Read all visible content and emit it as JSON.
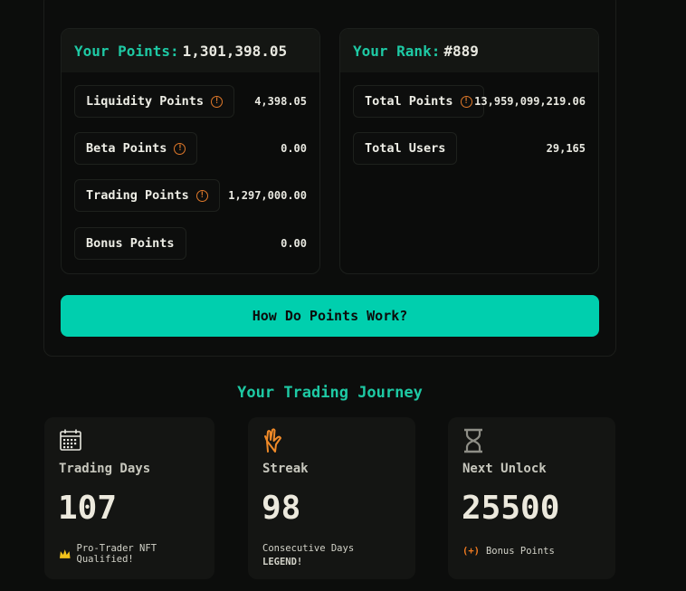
{
  "points": {
    "your_points_label": "Your Points:",
    "your_points_value": "1,301,398.05",
    "rows": [
      {
        "label": "Liquidity Points",
        "value": "4,398.05",
        "info": true
      },
      {
        "label": "Beta Points",
        "value": "0.00",
        "info": true
      },
      {
        "label": "Trading Points",
        "value": "1,297,000.00",
        "info": true
      },
      {
        "label": "Bonus Points",
        "value": "0.00",
        "info": false
      }
    ]
  },
  "rank": {
    "your_rank_label": "Your Rank:",
    "your_rank_value": "#889",
    "rows": [
      {
        "label": "Total Points",
        "value": "13,959,099,219.06",
        "info": true
      },
      {
        "label": "Total Users",
        "value": "29,165",
        "info": false
      }
    ]
  },
  "cta": {
    "label": "How Do Points Work?"
  },
  "journey": {
    "title": "Your Trading Journey",
    "cards": [
      {
        "icon": "calendar-icon",
        "label": "Trading Days",
        "value": "107",
        "note": "Pro-Trader NFT Qualified!"
      },
      {
        "icon": "hand-icon",
        "label": "Streak",
        "value": "98",
        "note": "Consecutive Days",
        "note2": "LEGEND!"
      },
      {
        "icon": "hourglass-icon",
        "label": "Next Unlock",
        "value": "25500",
        "note_prefix": "(+)",
        "note": "Bonus Points"
      }
    ]
  },
  "colors": {
    "accent": "#1ec9a4",
    "button": "#00cfae",
    "warning": "#e0792a"
  }
}
